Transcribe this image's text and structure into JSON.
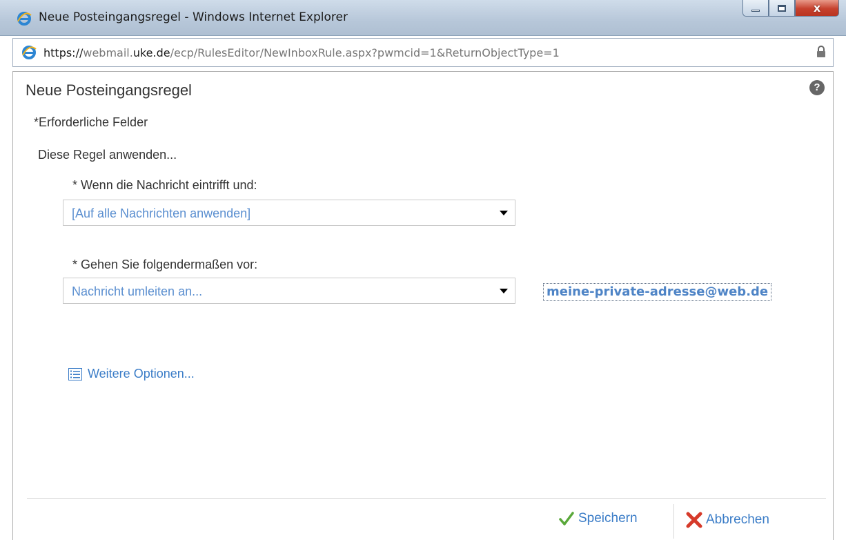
{
  "window": {
    "title": "Neue Posteingangsregel - Windows Internet Explorer",
    "close_glyph": "x"
  },
  "address": {
    "scheme": "https://",
    "host_pre": "webmail.",
    "host_domain": "uke.de",
    "path": "/ecp/RulesEditor/NewInboxRule.aspx?pwmcid=1&ReturnObjectType=1"
  },
  "dialog": {
    "title": "Neue Posteingangsregel",
    "help": "?",
    "required_note": "*Erforderliche Felder",
    "apply_rule": "Diese Regel anwenden...",
    "condition_label": "* Wenn die Nachricht eintrifft und:",
    "condition_value": "[Auf alle Nachrichten anwenden]",
    "action_label": "* Gehen Sie folgendermaßen vor:",
    "action_value": "Nachricht umleiten an...",
    "redirect_address": "meine-private-adresse@web.de",
    "more_options": "Weitere Optionen...",
    "save_label": "Speichern",
    "cancel_label": "Abbrechen"
  },
  "icons": {
    "browser": "ie-icon",
    "lock": "lock-icon",
    "help": "help-icon",
    "more_options": "list-icon",
    "save": "check-icon",
    "cancel": "x-icon"
  },
  "colors": {
    "link": "#3a7cc7",
    "select_value": "#5b8fd0",
    "save_check": "#5aa83a",
    "cancel_x": "#d63a2a"
  }
}
